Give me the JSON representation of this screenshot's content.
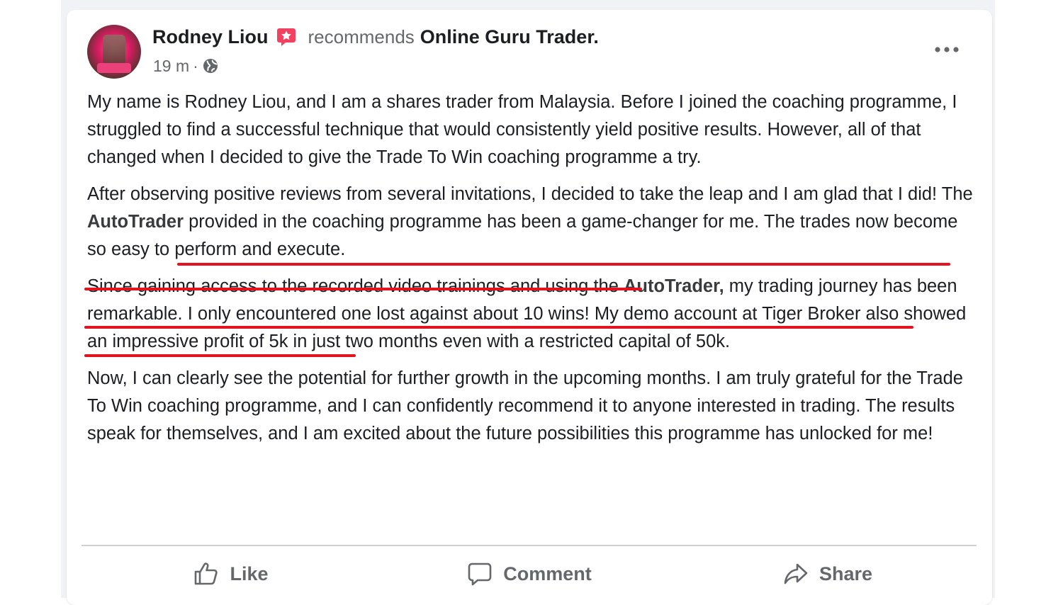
{
  "post": {
    "author": "Rodney Liou",
    "action": "recommends",
    "page_name": "Online Guru Trader.",
    "time": "19 m",
    "separator": "·",
    "paragraphs": [
      {
        "t1": "My name is Rodney Liou, and I am a shares trader from Malaysia. Before I joined the coaching programme, I struggled to find a successful technique that would consistently yield positive results. However, all of that changed when I decided to give the Trade To Win coaching programme a try."
      },
      {
        "t1": "After observing positive reviews from several invitations, I decided to take the leap and I am glad that I did! The ",
        "h1": "AutoTrader",
        "t2": " provided in the coaching programme has been a game-changer for me. The trades now become so easy to perform and execute."
      },
      {
        "t1": "Since gaining access to the recorded video trainings and using the ",
        "h1": "AutoTrader,",
        "t2": " my trading journey has been remarkable. I only encountered one lost against about 10 wins! My demo account at Tiger Broker also showed an impressive profit of 5k in just two months even with a restricted capital of 50k."
      },
      {
        "t1": "Now, I can clearly see the potential for further growth in the upcoming months. I am truly grateful for the Trade To Win coaching programme, and I can confidently recommend it to anyone interested in trading. The results speak for themselves, and I am excited about the future possibilities this programme has unlocked for me!"
      }
    ]
  },
  "actions": {
    "like": "Like",
    "comment": "Comment",
    "share": "Share"
  },
  "icons": {
    "recommend_badge": "recommend-star-icon",
    "globe": "globe-icon",
    "more": "more-options-icon",
    "like": "thumbs-up-icon",
    "comment": "comment-bubble-icon",
    "share": "share-arrow-icon"
  },
  "colors": {
    "highlight_underline": "#e3141f",
    "badge": "#f3425f",
    "text_primary": "#1c1e21",
    "text_secondary": "#65676b"
  }
}
